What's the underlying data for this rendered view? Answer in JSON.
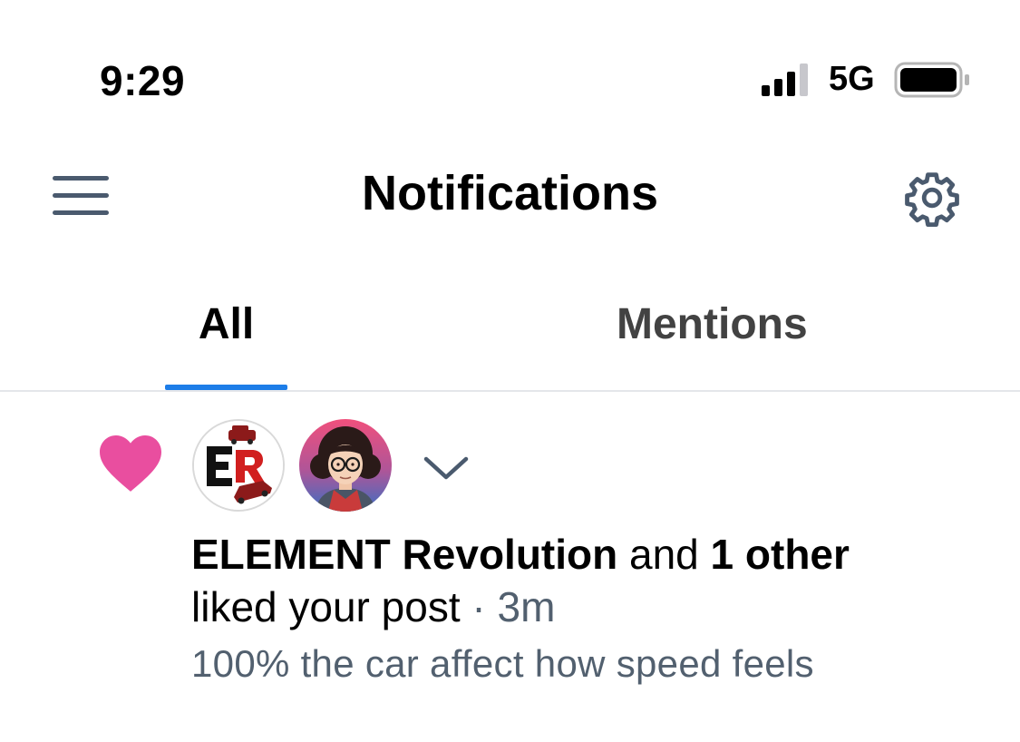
{
  "status_bar": {
    "time": "9:29",
    "network": "5G",
    "signal_bars_active": 3,
    "signal_bars_total": 4,
    "battery_level": 1.0
  },
  "header": {
    "title": "Notifications",
    "menu_icon": "hamburger-menu-icon",
    "settings_icon": "gear-icon"
  },
  "tabs": [
    {
      "label": "All",
      "active": true
    },
    {
      "label": "Mentions",
      "active": false
    }
  ],
  "colors": {
    "accent": "#1d7de8",
    "like": "#e94e9f",
    "muted_text": "#52606f",
    "icon": "#4a5a6e"
  },
  "notification": {
    "type_icon": "heart-icon",
    "actor_name": "ELEMENT Revolution",
    "conjunction": " and ",
    "others": "1 other",
    "action": "liked your post",
    "separator": " · ",
    "time_ago": "3m",
    "post_preview": "100% the car affect how speed feels",
    "avatars": [
      {
        "name": "element-revolution-avatar",
        "monogram": "ER"
      },
      {
        "name": "user-avatar",
        "monogram": ""
      }
    ]
  }
}
